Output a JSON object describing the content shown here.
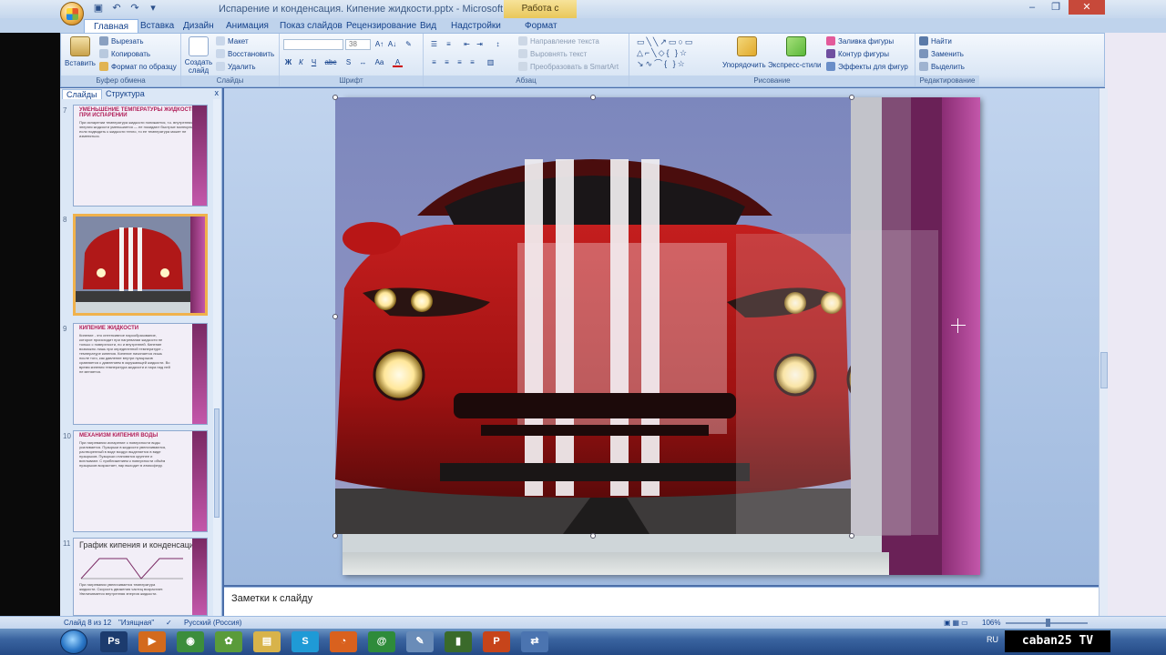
{
  "window": {
    "title": "Испарение и конденсация. Кипение жидкости.pptx - Microsoft PowerPoint",
    "contextual_tab": "Работа с рисунками"
  },
  "tabs": [
    "Главная",
    "Вставка",
    "Дизайн",
    "Анимация",
    "Показ слайдов",
    "Рецензирование",
    "Вид",
    "Надстройки",
    "Формат"
  ],
  "ribbon": {
    "clipboard": {
      "paste": "Вставить",
      "cut": "Вырезать",
      "copy": "Копировать",
      "format_painter": "Формат по образцу",
      "label": "Буфер обмена"
    },
    "slides": {
      "new_slide": "Создать слайд",
      "layout": "Макет",
      "reset": "Восстановить",
      "delete": "Удалить",
      "label": "Слайды"
    },
    "font": {
      "font_size": "38",
      "bold": "Ж",
      "italic": "К",
      "underline": "Ч",
      "strike": "abc",
      "label": "Шрифт"
    },
    "paragraph": {
      "text_direction": "Направление текста",
      "align_text": "Выровнять текст",
      "smartart": "Преобразовать в SmartArt",
      "label": "Абзац"
    },
    "drawing": {
      "arrange": "Упорядочить",
      "quick_styles": "Экспресс-стили",
      "shape_fill": "Заливка фигуры",
      "shape_outline": "Контур фигуры",
      "shape_effects": "Эффекты для фигур",
      "label": "Рисование"
    },
    "editing": {
      "find": "Найти",
      "replace": "Заменить",
      "select": "Выделить",
      "label": "Редактирование"
    }
  },
  "left_panel": {
    "tab_slides": "Слайды",
    "tab_outline": "Структура",
    "close": "x",
    "thumbnails": [
      {
        "num": "7",
        "title": "УМЕНЬШЕНИЕ ТЕМПЕРАТУРЫ ЖИДКОСТИ ПРИ ИСПАРЕНИИ",
        "text": "При испарении температура жидкости понижается, т.к. внутренняя энергия жидкости уменьшается — ее покидают быстрые молекулы. Но, если подводить к жидкости тепло, то ее температура может не изменяться."
      },
      {
        "num": "8",
        "title": "",
        "text": ""
      },
      {
        "num": "9",
        "title": "КИПЕНИЕ ЖИДКОСТИ",
        "text": "Кипение - это интенсивное парообразование, которое происходит при нагревании жидкости не только с поверхности, но и внутренней. Кипение возможно лишь при определенной температуре - температуре кипения. Кипение начинается лишь после того, как давление внутри пузырьков сравняется с давлением в окружающей жидкости. Во время кипения температура жидкости и пара над ней не меняется."
      },
      {
        "num": "10",
        "title": "МЕХАНИЗМ КИПЕНИЯ ВОДЫ",
        "text": "При нагревании испарение с поверхности воды усиливается. Пузырьки в жидкости увеличиваются, растворенный в воде воздух выделяется в виде пузырьков. Пузырьки становятся крупнее и всплывают. С приближением к поверхности объём пузырьков возрастает, пар выходит в атмосферу."
      },
      {
        "num": "11",
        "title": "График кипения и конденсации",
        "text": "При нагревании увеличивается температура жидкости. Скорость движения частиц возрастает. Увеличивается внутренняя энергия жидкости."
      }
    ]
  },
  "notes": {
    "placeholder": "Заметки к слайду"
  },
  "status": {
    "slide_counter": "Слайд 8 из 12",
    "theme": "\"Изящная\"",
    "language": "Русский (Россия)",
    "zoom": "106%"
  },
  "taskbar": {
    "items": [
      {
        "name": "photoshop-icon",
        "glyph": "Ps",
        "color": "#1c3b6e"
      },
      {
        "name": "media-player-icon",
        "glyph": "▶",
        "color": "#d36a1d"
      },
      {
        "name": "chrome-icon",
        "glyph": "◉",
        "color": "#3c8d3c"
      },
      {
        "name": "butterfly-icon",
        "glyph": "✿",
        "color": "#5a9b3a"
      },
      {
        "name": "folder-icon",
        "glyph": "▤",
        "color": "#d8b34a"
      },
      {
        "name": "skype-icon",
        "glyph": "S",
        "color": "#1f9ad6"
      },
      {
        "name": "firefox-icon",
        "glyph": "◔",
        "color": "#d9611e"
      },
      {
        "name": "mail-agent-icon",
        "glyph": "@",
        "color": "#2e8b3a"
      },
      {
        "name": "paint-icon",
        "glyph": "✎",
        "color": "#6a8cb8"
      },
      {
        "name": "cmd-icon",
        "glyph": "▮",
        "color": "#3a6a2a"
      },
      {
        "name": "powerpoint-icon",
        "glyph": "P",
        "color": "#c7441a"
      },
      {
        "name": "network-icon",
        "glyph": "⇄",
        "color": "#4b74b0"
      }
    ],
    "tray_lang": "RU",
    "watermark": "caban25 TV"
  }
}
